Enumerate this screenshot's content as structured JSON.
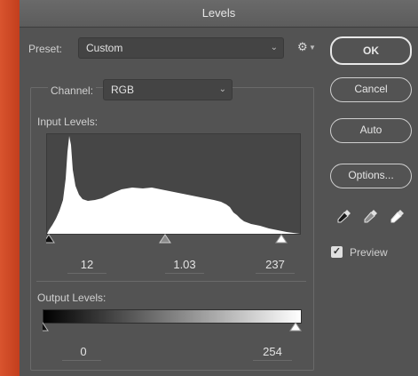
{
  "window": {
    "title": "Levels"
  },
  "preset": {
    "label": "Preset:",
    "value": "Custom"
  },
  "channel": {
    "label": "Channel:",
    "value": "RGB"
  },
  "input_levels": {
    "label": "Input Levels:",
    "black": "12",
    "gamma": "1.03",
    "white": "237",
    "black_level": 12,
    "gamma_level": 1.03,
    "white_level": 237
  },
  "output_levels": {
    "label": "Output Levels:",
    "black": "0",
    "white": "254",
    "black_level": 0,
    "white_level": 254
  },
  "buttons": {
    "ok": "OK",
    "cancel": "Cancel",
    "auto": "Auto",
    "options": "Options..."
  },
  "preview": {
    "label": "Preview",
    "checked": true
  },
  "icons": {
    "gear": "gear-icon",
    "black_eyedropper": "eyedropper-black-icon",
    "gray_eyedropper": "eyedropper-gray-icon",
    "white_eyedropper": "eyedropper-white-icon"
  }
}
